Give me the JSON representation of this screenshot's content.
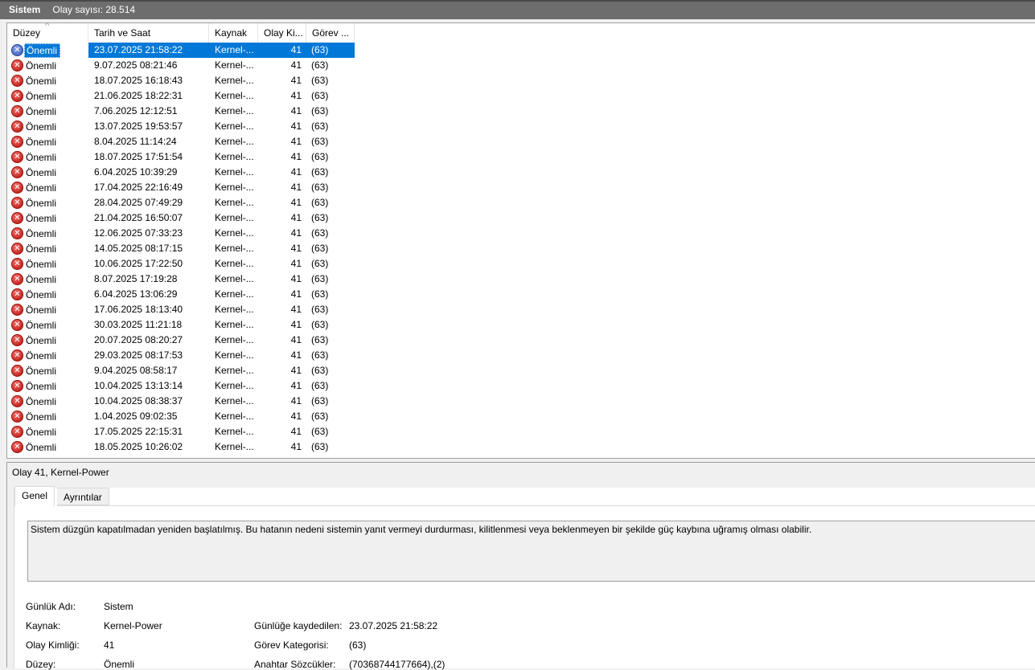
{
  "titlebar": {
    "log_name": "Sistem",
    "event_count": "Olay sayısı: 28.514"
  },
  "columns": [
    "Düzey",
    "Tarih ve Saat",
    "Kaynak",
    "Olay Ki...",
    "Görev ..."
  ],
  "rows": [
    {
      "level": "Önemli",
      "date": "23.07.2025 21:58:22",
      "source": "Kernel-...",
      "id": "41",
      "task": "(63)"
    },
    {
      "level": "Önemli",
      "date": "9.07.2025 08:21:46",
      "source": "Kernel-...",
      "id": "41",
      "task": "(63)"
    },
    {
      "level": "Önemli",
      "date": "18.07.2025 16:18:43",
      "source": "Kernel-...",
      "id": "41",
      "task": "(63)"
    },
    {
      "level": "Önemli",
      "date": "21.06.2025 18:22:31",
      "source": "Kernel-...",
      "id": "41",
      "task": "(63)"
    },
    {
      "level": "Önemli",
      "date": "7.06.2025 12:12:51",
      "source": "Kernel-...",
      "id": "41",
      "task": "(63)"
    },
    {
      "level": "Önemli",
      "date": "13.07.2025 19:53:57",
      "source": "Kernel-...",
      "id": "41",
      "task": "(63)"
    },
    {
      "level": "Önemli",
      "date": "8.04.2025 11:14:24",
      "source": "Kernel-...",
      "id": "41",
      "task": "(63)"
    },
    {
      "level": "Önemli",
      "date": "18.07.2025 17:51:54",
      "source": "Kernel-...",
      "id": "41",
      "task": "(63)"
    },
    {
      "level": "Önemli",
      "date": "6.04.2025 10:39:29",
      "source": "Kernel-...",
      "id": "41",
      "task": "(63)"
    },
    {
      "level": "Önemli",
      "date": "17.04.2025 22:16:49",
      "source": "Kernel-...",
      "id": "41",
      "task": "(63)"
    },
    {
      "level": "Önemli",
      "date": "28.04.2025 07:49:29",
      "source": "Kernel-...",
      "id": "41",
      "task": "(63)"
    },
    {
      "level": "Önemli",
      "date": "21.04.2025 16:50:07",
      "source": "Kernel-...",
      "id": "41",
      "task": "(63)"
    },
    {
      "level": "Önemli",
      "date": "12.06.2025 07:33:23",
      "source": "Kernel-...",
      "id": "41",
      "task": "(63)"
    },
    {
      "level": "Önemli",
      "date": "14.05.2025 08:17:15",
      "source": "Kernel-...",
      "id": "41",
      "task": "(63)"
    },
    {
      "level": "Önemli",
      "date": "10.06.2025 17:22:50",
      "source": "Kernel-...",
      "id": "41",
      "task": "(63)"
    },
    {
      "level": "Önemli",
      "date": "8.07.2025 17:19:28",
      "source": "Kernel-...",
      "id": "41",
      "task": "(63)"
    },
    {
      "level": "Önemli",
      "date": "6.04.2025 13:06:29",
      "source": "Kernel-...",
      "id": "41",
      "task": "(63)"
    },
    {
      "level": "Önemli",
      "date": "17.06.2025 18:13:40",
      "source": "Kernel-...",
      "id": "41",
      "task": "(63)"
    },
    {
      "level": "Önemli",
      "date": "30.03.2025 11:21:18",
      "source": "Kernel-...",
      "id": "41",
      "task": "(63)"
    },
    {
      "level": "Önemli",
      "date": "20.07.2025 08:20:27",
      "source": "Kernel-...",
      "id": "41",
      "task": "(63)"
    },
    {
      "level": "Önemli",
      "date": "29.03.2025 08:17:53",
      "source": "Kernel-...",
      "id": "41",
      "task": "(63)"
    },
    {
      "level": "Önemli",
      "date": "9.04.2025 08:58:17",
      "source": "Kernel-...",
      "id": "41",
      "task": "(63)"
    },
    {
      "level": "Önemli",
      "date": "10.04.2025 13:13:14",
      "source": "Kernel-...",
      "id": "41",
      "task": "(63)"
    },
    {
      "level": "Önemli",
      "date": "10.04.2025 08:38:37",
      "source": "Kernel-...",
      "id": "41",
      "task": "(63)"
    },
    {
      "level": "Önemli",
      "date": "1.04.2025 09:02:35",
      "source": "Kernel-...",
      "id": "41",
      "task": "(63)"
    },
    {
      "level": "Önemli",
      "date": "17.05.2025 22:15:31",
      "source": "Kernel-...",
      "id": "41",
      "task": "(63)"
    },
    {
      "level": "Önemli",
      "date": "18.05.2025 10:26:02",
      "source": "Kernel-...",
      "id": "41",
      "task": "(63)"
    }
  ],
  "selected_row": 0,
  "detail": {
    "title": "Olay 41, Kernel-Power",
    "tabs": [
      "Genel",
      "Ayrıntılar"
    ],
    "description": "Sistem düzgün kapatılmadan yeniden başlatılmış. Bu hatanın nedeni sistemin yanıt vermeyi durdurması, kilitlenmesi veya beklenmeyen bir şekilde güç kaybına uğramış olması olabilir.",
    "fields": {
      "log_name_label": "Günlük Adı:",
      "log_name_value": "Sistem",
      "source_label": "Kaynak:",
      "source_value": "Kernel-Power",
      "logged_label": "Günlüğe kaydedilen:",
      "logged_value": "23.07.2025 21:58:22",
      "event_id_label": "Olay Kimliği:",
      "event_id_value": "41",
      "task_cat_label": "Görev Kategorisi:",
      "task_cat_value": "(63)",
      "level_label": "Düzey:",
      "level_value": "Önemli",
      "keywords_label": "Anahtar Sözcükler:",
      "keywords_value": "(70368744177664),(2)"
    }
  },
  "icons": {
    "error": "error-x-icon"
  },
  "colors": {
    "selection": "#0078d7",
    "titlebar": "#6d6d6d",
    "error": "#c2211b"
  }
}
